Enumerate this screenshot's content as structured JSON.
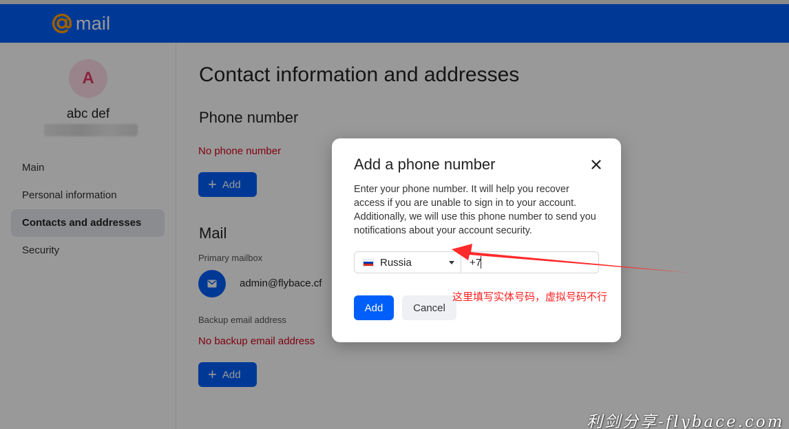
{
  "app": {
    "logo_text": "mail",
    "brand_color": "#005ff9",
    "logo_accent": "#ff9e00"
  },
  "user": {
    "avatar_letter": "A",
    "name": "abc def"
  },
  "sidebar": {
    "items": [
      {
        "label": "Main"
      },
      {
        "label": "Personal information"
      },
      {
        "label": "Contacts and addresses",
        "active": true
      },
      {
        "label": "Security"
      }
    ]
  },
  "main": {
    "title": "Contact information and addresses",
    "phone_section": {
      "title": "Phone number",
      "empty_text": "No phone number",
      "add_label": "Add"
    },
    "mail_section": {
      "title": "Mail",
      "primary_label": "Primary mailbox",
      "primary_address": "admin@flybace.cf",
      "backup_label": "Backup email address",
      "backup_empty_text": "No backup email address",
      "add_label": "Add"
    }
  },
  "dialog": {
    "title": "Add a phone number",
    "description": "Enter your phone number. It will help you recover access if you are unable to sign in to your account. Additionally, we will use this phone number to send you notifications about your account security.",
    "country": "Russia",
    "phone_value": "+7",
    "add_label": "Add",
    "cancel_label": "Cancel"
  },
  "annotation": {
    "text": "这里填写实体号码，虚拟号码不行",
    "color": "#ff2020"
  },
  "watermark": {
    "text": "利剑分享-flybace.com"
  },
  "icons": {
    "logo": "at-sign-icon",
    "close": "close-icon",
    "mailbox": "envelope-icon",
    "add": "plus-icon",
    "country": "russia-flag-icon",
    "select": "caret-down-icon"
  }
}
